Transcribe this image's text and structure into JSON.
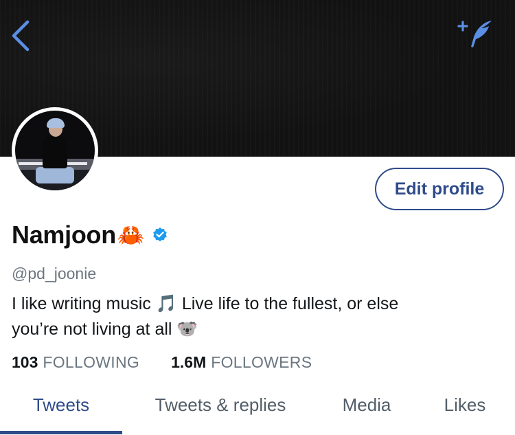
{
  "header": {
    "back_icon": "chevron-left-icon",
    "compose_icon": "sparkle-feather-icon",
    "accent_color": "#5b8ee3"
  },
  "profile": {
    "avatar_icon": "avatar-photo",
    "edit_button_label": "Edit profile",
    "display_name": "Namjoon",
    "name_emoji": "🦀",
    "verified_icon": "verified-badge-icon",
    "handle": "@pd_joonie",
    "bio_line1": "I like writing music 🎵 Live life to the fullest, or else",
    "bio_line2": "you’re not living at all 🐨"
  },
  "stats": {
    "following_count": "103",
    "following_label": "FOLLOWING",
    "followers_count": "1.6M",
    "followers_label": "FOLLOWERS"
  },
  "tabs": [
    {
      "label": "Tweets",
      "active": true
    },
    {
      "label": "Tweets & replies",
      "active": false
    },
    {
      "label": "Media",
      "active": false
    },
    {
      "label": "Likes",
      "active": false
    }
  ],
  "colors": {
    "brand": "#2f4b8a",
    "verified": "#1d9bf0",
    "muted": "#6b7680"
  }
}
